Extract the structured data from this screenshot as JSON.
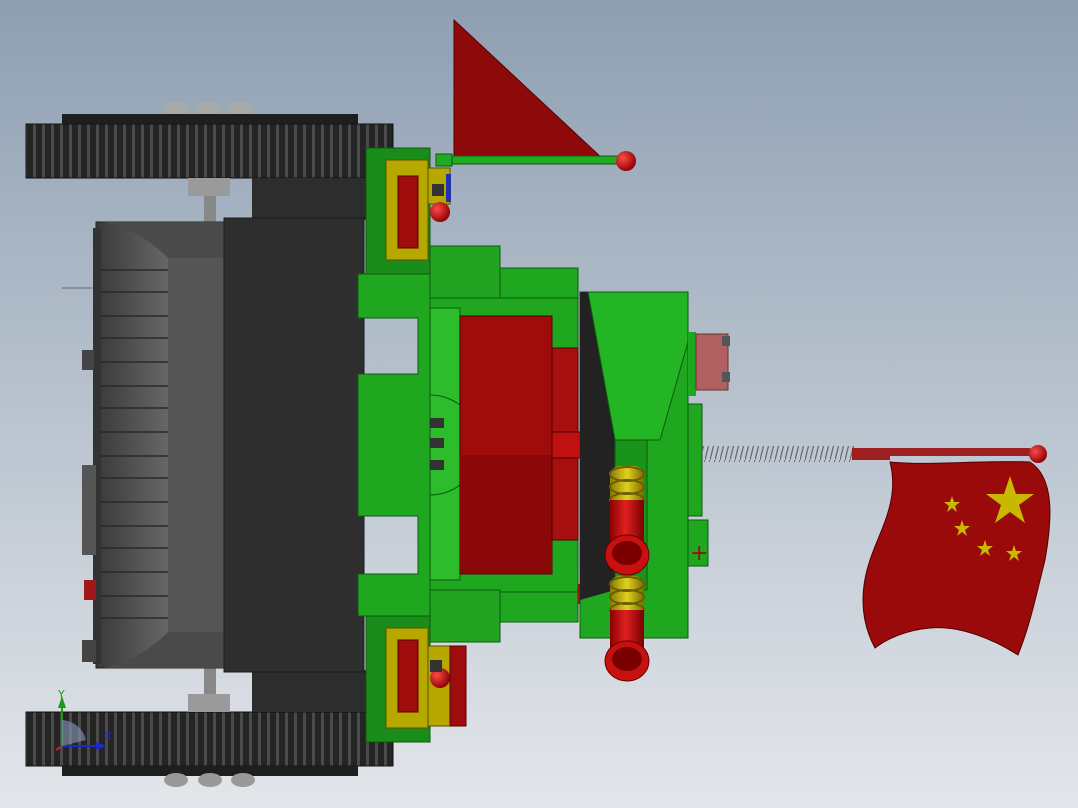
{
  "viewport": {
    "background_top": "#8e9fb2",
    "background_bottom": "#e3e6ea"
  },
  "colors": {
    "track": "#2b2b2b",
    "track_tread": "#555555",
    "chassis_dark": "#3a3a3a",
    "chassis_mid": "#4d4d4d",
    "green": "#1fa81f",
    "green_light": "#2ec02e",
    "red": "#9e0c0c",
    "red_dark": "#7a0808",
    "yellow": "#b7a800",
    "flag_red": "#9a0a0a",
    "star_yellow": "#c9b800",
    "pole_green": "#22aa22",
    "pink_cylinder": "#b06060",
    "spring": "#777777"
  },
  "triad": {
    "y_label": "Y",
    "x_label": "X",
    "icon": "axis-triad-icon"
  }
}
